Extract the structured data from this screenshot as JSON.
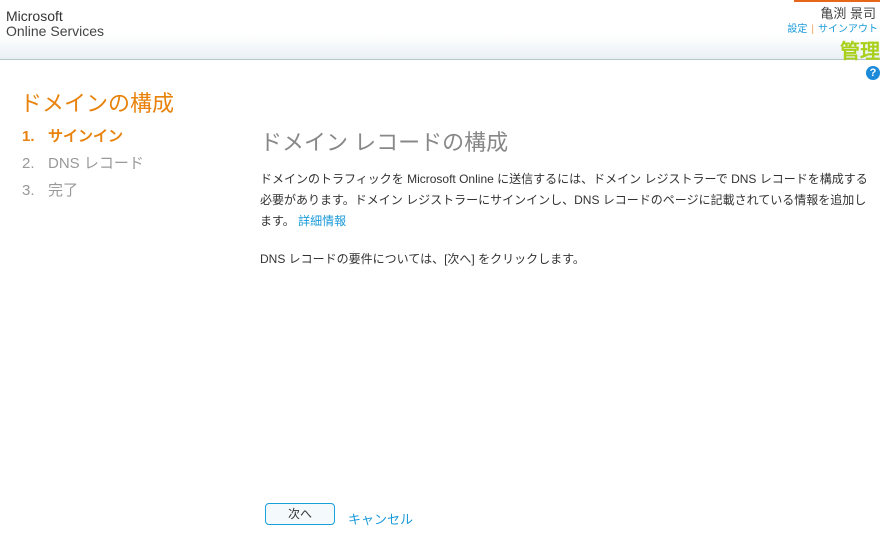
{
  "header": {
    "logo_line1": "Microsoft",
    "logo_line2": "Online Services",
    "user": "亀渕 景司",
    "settings": "設定",
    "separator": "|",
    "signout": "サインアウト",
    "admin": "管理",
    "help": "?"
  },
  "page": {
    "title": "ドメインの構成"
  },
  "steps": [
    {
      "num": "1.",
      "label": "サインイン"
    },
    {
      "num": "2.",
      "label": "DNS レコード"
    },
    {
      "num": "3.",
      "label": "完了"
    }
  ],
  "main": {
    "heading": "ドメイン レコードの構成",
    "para1": "ドメインのトラフィックを Microsoft Online に送信するには、ドメイン レジストラーで DNS レコードを構成する必要があります。ドメイン レジストラーにサインインし、DNS レコードのページに記載されている情報を追加します。",
    "more_link": "詳細情報",
    "para2": "DNS レコードの要件については、[次へ] をクリックします。"
  },
  "buttons": {
    "next": "次へ",
    "cancel": "キャンセル"
  }
}
